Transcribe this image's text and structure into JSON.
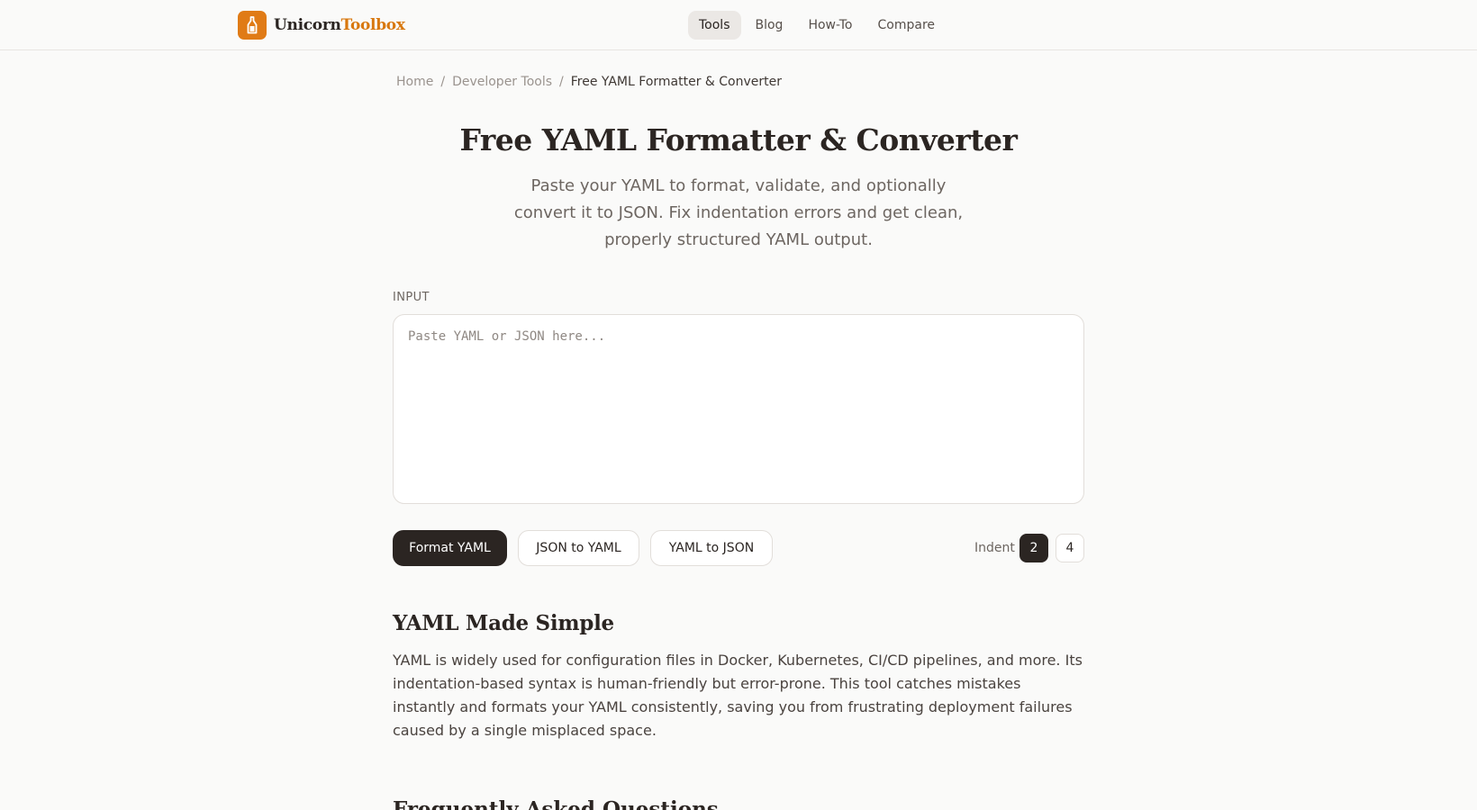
{
  "header": {
    "logo_icon": "bottle-icon",
    "brand_primary": "Unicorn",
    "brand_secondary": "Toolbox",
    "accent_color": "#e07b16",
    "nav": [
      "Tools",
      "Blog",
      "How-To",
      "Compare"
    ],
    "active_nav": "Tools"
  },
  "breadcrumb": {
    "home": "Home",
    "category": "Developer Tools",
    "current": "Free YAML Formatter & Converter",
    "separator": "/"
  },
  "page": {
    "title": "Free YAML Formatter & Converter",
    "subtitle": "Paste your YAML to format, validate, and optionally convert it to JSON. Fix indentation errors and get clean, properly structured YAML output."
  },
  "input": {
    "label": "INPUT",
    "placeholder": "Paste YAML or JSON here...",
    "value": ""
  },
  "actions": {
    "format": "Format YAML",
    "json_to_yaml": "JSON to YAML",
    "yaml_to_json": "YAML to JSON"
  },
  "indent": {
    "label": "Indent",
    "options": [
      "2",
      "4"
    ],
    "selected": "2"
  },
  "section": {
    "title": "YAML Made Simple",
    "body": "YAML is widely used for configuration files in Docker, Kubernetes, CI/CD pipelines, and more. Its indentation-based syntax is human-friendly but error-prone. This tool catches mistakes instantly and formats your YAML consistently, saving you from frustrating deployment failures caused by a single misplaced space."
  },
  "faq": {
    "title": "Frequently Asked Questions"
  }
}
